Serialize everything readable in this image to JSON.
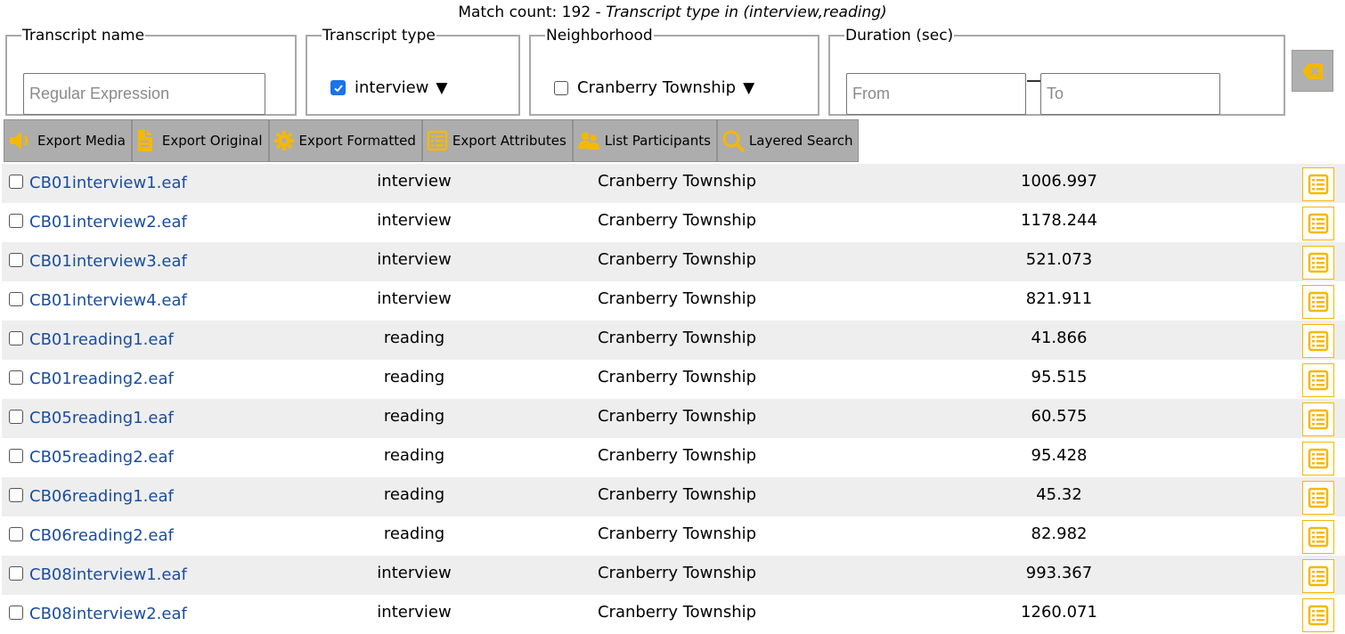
{
  "summary": {
    "prefix": "Match count: 192 - ",
    "description": "Transcript type in (interview,reading)"
  },
  "filters": {
    "transcript_name": {
      "legend": "Transcript name",
      "placeholder": "Regular Expression",
      "value": ""
    },
    "transcript_type": {
      "legend": "Transcript type",
      "selected": "interview",
      "checked": true
    },
    "neighborhood": {
      "legend": "Neighborhood",
      "selected": "Cranberry Township",
      "checked": false
    },
    "duration": {
      "legend": "Duration (sec)",
      "from_placeholder": "From",
      "to_placeholder": "To",
      "from_value": "",
      "to_value": ""
    },
    "caret": "▼",
    "clear_icon": "clear-filter-icon"
  },
  "toolbar": {
    "export_media": "Export Media",
    "export_original": "Export Original",
    "export_formatted": "Export Formatted",
    "export_attributes": "Export Attributes",
    "list_participants": "List Participants",
    "layered_search": "Layered Search"
  },
  "colors": {
    "accent": "#f5b800",
    "link": "#1a4d9e",
    "toolbar_bg": "#adadad",
    "row_alt": "#eeeeee",
    "checkbox": "#1a73e8"
  },
  "rows": [
    {
      "name": "CB01interview1.eaf",
      "type": "interview",
      "neighborhood": "Cranberry Township",
      "duration": "1006.997"
    },
    {
      "name": "CB01interview2.eaf",
      "type": "interview",
      "neighborhood": "Cranberry Township",
      "duration": "1178.244"
    },
    {
      "name": "CB01interview3.eaf",
      "type": "interview",
      "neighborhood": "Cranberry Township",
      "duration": "521.073"
    },
    {
      "name": "CB01interview4.eaf",
      "type": "interview",
      "neighborhood": "Cranberry Township",
      "duration": "821.911"
    },
    {
      "name": "CB01reading1.eaf",
      "type": "reading",
      "neighborhood": "Cranberry Township",
      "duration": "41.866"
    },
    {
      "name": "CB01reading2.eaf",
      "type": "reading",
      "neighborhood": "Cranberry Township",
      "duration": "95.515"
    },
    {
      "name": "CB05reading1.eaf",
      "type": "reading",
      "neighborhood": "Cranberry Township",
      "duration": "60.575"
    },
    {
      "name": "CB05reading2.eaf",
      "type": "reading",
      "neighborhood": "Cranberry Township",
      "duration": "95.428"
    },
    {
      "name": "CB06reading1.eaf",
      "type": "reading",
      "neighborhood": "Cranberry Township",
      "duration": "45.32"
    },
    {
      "name": "CB06reading2.eaf",
      "type": "reading",
      "neighborhood": "Cranberry Township",
      "duration": "82.982"
    },
    {
      "name": "CB08interview1.eaf",
      "type": "interview",
      "neighborhood": "Cranberry Township",
      "duration": "993.367"
    },
    {
      "name": "CB08interview2.eaf",
      "type": "interview",
      "neighborhood": "Cranberry Township",
      "duration": "1260.071"
    }
  ]
}
